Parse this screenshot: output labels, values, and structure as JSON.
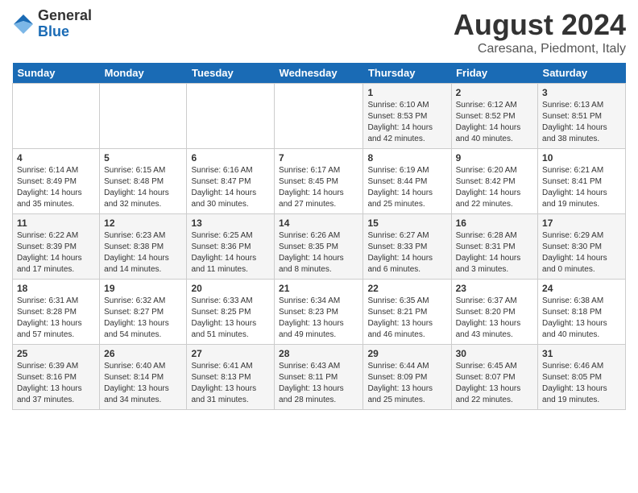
{
  "header": {
    "logo_general": "General",
    "logo_blue": "Blue",
    "month_title": "August 2024",
    "location": "Caresana, Piedmont, Italy"
  },
  "weekdays": [
    "Sunday",
    "Monday",
    "Tuesday",
    "Wednesday",
    "Thursday",
    "Friday",
    "Saturday"
  ],
  "weeks": [
    [
      {
        "day": "",
        "info": ""
      },
      {
        "day": "",
        "info": ""
      },
      {
        "day": "",
        "info": ""
      },
      {
        "day": "",
        "info": ""
      },
      {
        "day": "1",
        "info": "Sunrise: 6:10 AM\nSunset: 8:53 PM\nDaylight: 14 hours\nand 42 minutes."
      },
      {
        "day": "2",
        "info": "Sunrise: 6:12 AM\nSunset: 8:52 PM\nDaylight: 14 hours\nand 40 minutes."
      },
      {
        "day": "3",
        "info": "Sunrise: 6:13 AM\nSunset: 8:51 PM\nDaylight: 14 hours\nand 38 minutes."
      }
    ],
    [
      {
        "day": "4",
        "info": "Sunrise: 6:14 AM\nSunset: 8:49 PM\nDaylight: 14 hours\nand 35 minutes."
      },
      {
        "day": "5",
        "info": "Sunrise: 6:15 AM\nSunset: 8:48 PM\nDaylight: 14 hours\nand 32 minutes."
      },
      {
        "day": "6",
        "info": "Sunrise: 6:16 AM\nSunset: 8:47 PM\nDaylight: 14 hours\nand 30 minutes."
      },
      {
        "day": "7",
        "info": "Sunrise: 6:17 AM\nSunset: 8:45 PM\nDaylight: 14 hours\nand 27 minutes."
      },
      {
        "day": "8",
        "info": "Sunrise: 6:19 AM\nSunset: 8:44 PM\nDaylight: 14 hours\nand 25 minutes."
      },
      {
        "day": "9",
        "info": "Sunrise: 6:20 AM\nSunset: 8:42 PM\nDaylight: 14 hours\nand 22 minutes."
      },
      {
        "day": "10",
        "info": "Sunrise: 6:21 AM\nSunset: 8:41 PM\nDaylight: 14 hours\nand 19 minutes."
      }
    ],
    [
      {
        "day": "11",
        "info": "Sunrise: 6:22 AM\nSunset: 8:39 PM\nDaylight: 14 hours\nand 17 minutes."
      },
      {
        "day": "12",
        "info": "Sunrise: 6:23 AM\nSunset: 8:38 PM\nDaylight: 14 hours\nand 14 minutes."
      },
      {
        "day": "13",
        "info": "Sunrise: 6:25 AM\nSunset: 8:36 PM\nDaylight: 14 hours\nand 11 minutes."
      },
      {
        "day": "14",
        "info": "Sunrise: 6:26 AM\nSunset: 8:35 PM\nDaylight: 14 hours\nand 8 minutes."
      },
      {
        "day": "15",
        "info": "Sunrise: 6:27 AM\nSunset: 8:33 PM\nDaylight: 14 hours\nand 6 minutes."
      },
      {
        "day": "16",
        "info": "Sunrise: 6:28 AM\nSunset: 8:31 PM\nDaylight: 14 hours\nand 3 minutes."
      },
      {
        "day": "17",
        "info": "Sunrise: 6:29 AM\nSunset: 8:30 PM\nDaylight: 14 hours\nand 0 minutes."
      }
    ],
    [
      {
        "day": "18",
        "info": "Sunrise: 6:31 AM\nSunset: 8:28 PM\nDaylight: 13 hours\nand 57 minutes."
      },
      {
        "day": "19",
        "info": "Sunrise: 6:32 AM\nSunset: 8:27 PM\nDaylight: 13 hours\nand 54 minutes."
      },
      {
        "day": "20",
        "info": "Sunrise: 6:33 AM\nSunset: 8:25 PM\nDaylight: 13 hours\nand 51 minutes."
      },
      {
        "day": "21",
        "info": "Sunrise: 6:34 AM\nSunset: 8:23 PM\nDaylight: 13 hours\nand 49 minutes."
      },
      {
        "day": "22",
        "info": "Sunrise: 6:35 AM\nSunset: 8:21 PM\nDaylight: 13 hours\nand 46 minutes."
      },
      {
        "day": "23",
        "info": "Sunrise: 6:37 AM\nSunset: 8:20 PM\nDaylight: 13 hours\nand 43 minutes."
      },
      {
        "day": "24",
        "info": "Sunrise: 6:38 AM\nSunset: 8:18 PM\nDaylight: 13 hours\nand 40 minutes."
      }
    ],
    [
      {
        "day": "25",
        "info": "Sunrise: 6:39 AM\nSunset: 8:16 PM\nDaylight: 13 hours\nand 37 minutes."
      },
      {
        "day": "26",
        "info": "Sunrise: 6:40 AM\nSunset: 8:14 PM\nDaylight: 13 hours\nand 34 minutes."
      },
      {
        "day": "27",
        "info": "Sunrise: 6:41 AM\nSunset: 8:13 PM\nDaylight: 13 hours\nand 31 minutes."
      },
      {
        "day": "28",
        "info": "Sunrise: 6:43 AM\nSunset: 8:11 PM\nDaylight: 13 hours\nand 28 minutes."
      },
      {
        "day": "29",
        "info": "Sunrise: 6:44 AM\nSunset: 8:09 PM\nDaylight: 13 hours\nand 25 minutes."
      },
      {
        "day": "30",
        "info": "Sunrise: 6:45 AM\nSunset: 8:07 PM\nDaylight: 13 hours\nand 22 minutes."
      },
      {
        "day": "31",
        "info": "Sunrise: 6:46 AM\nSunset: 8:05 PM\nDaylight: 13 hours\nand 19 minutes."
      }
    ]
  ]
}
